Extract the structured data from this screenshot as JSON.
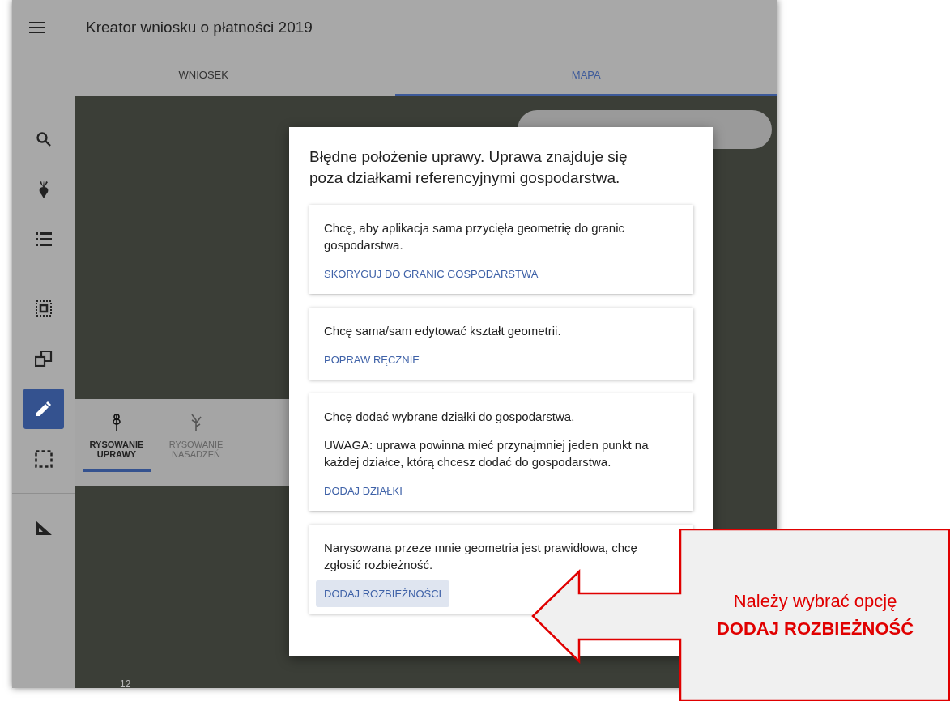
{
  "app": {
    "title": "Kreator wniosku o płatności 2019"
  },
  "tabs": [
    {
      "label": "WNIOSEK",
      "selected": false
    },
    {
      "label": "MAPA",
      "selected": true
    }
  ],
  "rail": [
    {
      "kind": "search",
      "selected": false
    },
    {
      "kind": "beet",
      "selected": false
    },
    {
      "kind": "list",
      "selected": false
    },
    {
      "kind": "divider"
    },
    {
      "kind": "select",
      "selected": false
    },
    {
      "kind": "copy",
      "selected": false
    },
    {
      "kind": "pencil",
      "selected": true
    },
    {
      "kind": "dashed",
      "selected": false
    },
    {
      "kind": "divider"
    },
    {
      "kind": "ruler",
      "selected": false
    }
  ],
  "draw_tabs": [
    {
      "label": "RYSOWANIE UPRAWY",
      "kind": "crop",
      "selected": true
    },
    {
      "label": "RYSOWANIE NASADZEŃ",
      "kind": "plant",
      "selected": false
    }
  ],
  "map": {
    "scale_label": "12"
  },
  "dialog": {
    "title": "Błędne położenie uprawy. Uprawa znajduje się poza działkami referencyjnymi gospodarstwa.",
    "options": [
      {
        "paragraphs": [
          "Chcę, aby aplikacja sama przycięła geometrię do granic gospodarstwa."
        ],
        "action": "SKORYGUJ DO GRANIC GOSPODARSTWA",
        "focused": false
      },
      {
        "paragraphs": [
          "Chcę sama/sam edytować kształt geometrii."
        ],
        "action": "POPRAW RĘCZNIE",
        "focused": false
      },
      {
        "paragraphs": [
          "Chcę dodać wybrane działki do gospodarstwa.",
          "UWAGA: uprawa powinna mieć przynajmniej jeden punkt na każdej działce, którą chcesz dodać do gospodarstwa."
        ],
        "action": "DODAJ DZIAŁKI",
        "focused": false
      },
      {
        "paragraphs": [
          "Narysowana przeze mnie geometria jest prawidłowa, chcę zgłosić rozbieżność."
        ],
        "action": "DODAJ ROZBIEŻNOŚCI",
        "focused": true
      }
    ]
  },
  "callout": {
    "text": "Należy wybrać opcję",
    "emphasis": "DODAJ ROZBIEŻNOŚĆ"
  }
}
